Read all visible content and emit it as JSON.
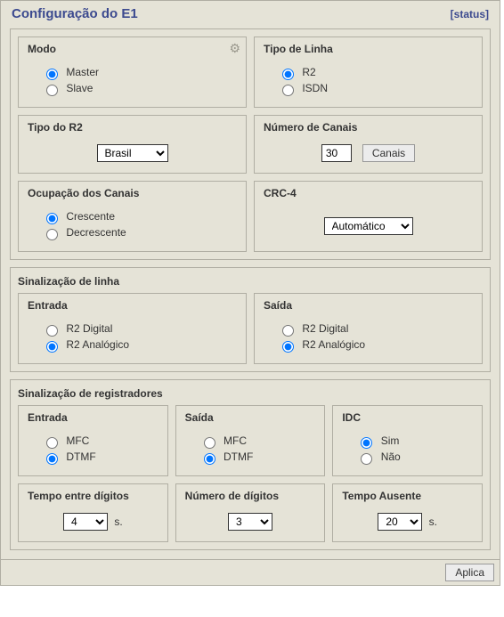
{
  "header": {
    "title": "Configuração do E1",
    "status": "[status]"
  },
  "modo": {
    "legend": "Modo",
    "master": "Master",
    "slave": "Slave"
  },
  "tipoLinha": {
    "legend": "Tipo de Linha",
    "r2": "R2",
    "isdn": "ISDN"
  },
  "tipoR2": {
    "legend": "Tipo do R2",
    "selected": "Brasil"
  },
  "numCanais": {
    "legend": "Número de Canais",
    "value": "30",
    "btn": "Canais"
  },
  "ocupacao": {
    "legend": "Ocupação dos Canais",
    "crescente": "Crescente",
    "decrescente": "Decrescente"
  },
  "crc4": {
    "legend": "CRC-4",
    "selected": "Automático"
  },
  "sinLinha": {
    "title": "Sinalização de linha",
    "entrada": {
      "legend": "Entrada",
      "digital": "R2 Digital",
      "analogico": "R2 Analógico"
    },
    "saida": {
      "legend": "Saída",
      "digital": "R2 Digital",
      "analogico": "R2 Analógico"
    }
  },
  "sinReg": {
    "title": "Sinalização de registradores",
    "entrada": {
      "legend": "Entrada",
      "mfc": "MFC",
      "dtmf": "DTMF"
    },
    "saida": {
      "legend": "Saída",
      "mfc": "MFC",
      "dtmf": "DTMF"
    },
    "idc": {
      "legend": "IDC",
      "sim": "Sim",
      "nao": "Não"
    },
    "tempoDig": {
      "legend": "Tempo entre dígitos",
      "value": "4",
      "suffix": "s."
    },
    "numDig": {
      "legend": "Número de dígitos",
      "value": "3"
    },
    "tempoAus": {
      "legend": "Tempo Ausente",
      "value": "20",
      "suffix": "s."
    }
  },
  "footer": {
    "apply": "Aplica"
  }
}
